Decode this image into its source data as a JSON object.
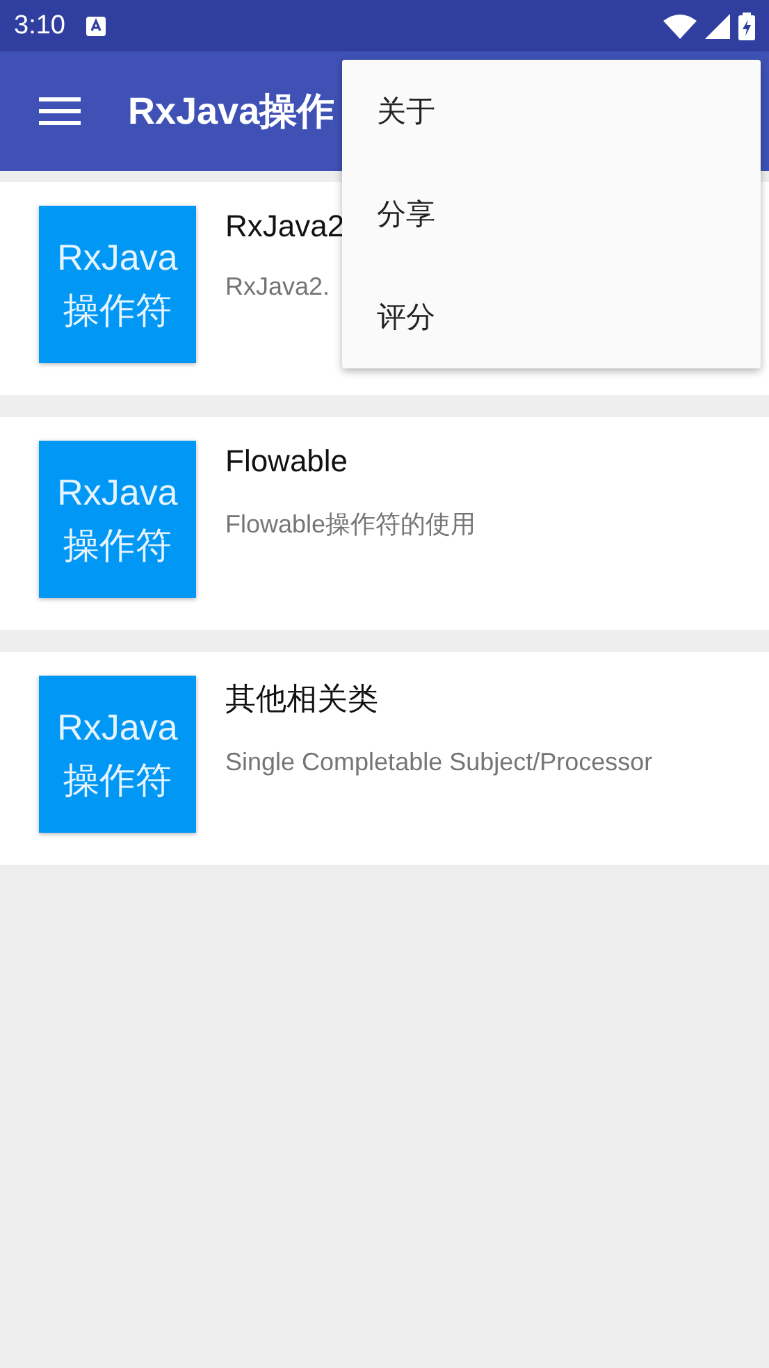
{
  "status_bar": {
    "time": "3:10"
  },
  "app_bar": {
    "title": "RxJava操作"
  },
  "list": [
    {
      "icon_lines": [
        "RxJava",
        "操作符"
      ],
      "title": "RxJava2",
      "subtitle": "RxJava2."
    },
    {
      "icon_lines": [
        "RxJava",
        "操作符"
      ],
      "title": "Flowable",
      "subtitle": "Flowable操作符的使用"
    },
    {
      "icon_lines": [
        "RxJava",
        "操作符"
      ],
      "title": "其他相关类",
      "subtitle": "Single Completable Subject/Processor"
    }
  ],
  "menu": {
    "items": [
      "关于",
      "分享",
      "评分"
    ]
  }
}
